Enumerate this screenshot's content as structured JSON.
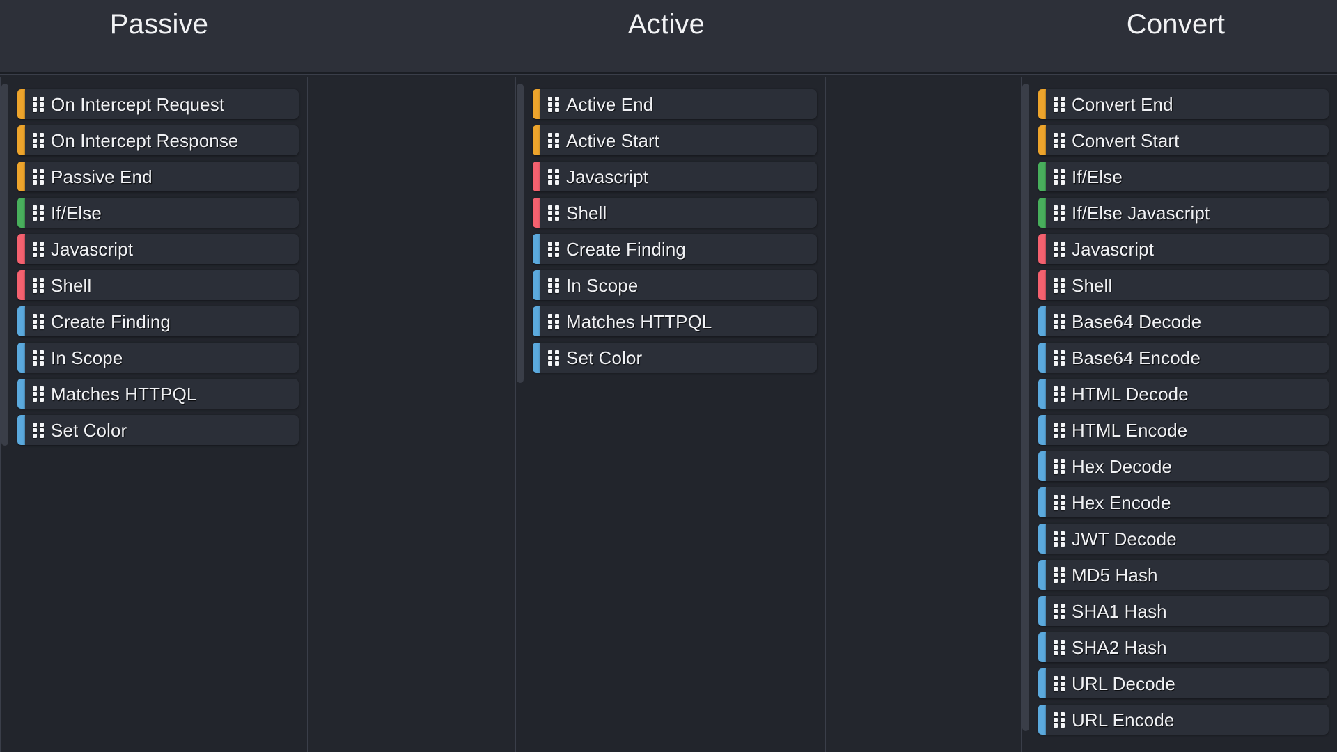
{
  "colors": {
    "stripe_orange": "#eda42c",
    "stripe_green": "#48af5c",
    "stripe_red": "#f4616f",
    "stripe_blue": "#5ba9dd",
    "header_background": "#2d3039",
    "panel_background": "#22252c",
    "item_background": "#2b2f38",
    "text": "#f0f1f4",
    "divider": "#3a3e49"
  },
  "columns": [
    {
      "id": "passive",
      "title": "Passive",
      "items": [
        {
          "label": "On Intercept Request",
          "color": "#eda42c",
          "icon": "drag-handle-icon"
        },
        {
          "label": "On Intercept Response",
          "color": "#eda42c",
          "icon": "drag-handle-icon"
        },
        {
          "label": "Passive End",
          "color": "#eda42c",
          "icon": "drag-handle-icon"
        },
        {
          "label": "If/Else",
          "color": "#48af5c",
          "icon": "drag-handle-icon"
        },
        {
          "label": "Javascript",
          "color": "#f4616f",
          "icon": "drag-handle-icon"
        },
        {
          "label": "Shell",
          "color": "#f4616f",
          "icon": "drag-handle-icon"
        },
        {
          "label": "Create Finding",
          "color": "#5ba9dd",
          "icon": "drag-handle-icon"
        },
        {
          "label": "In Scope",
          "color": "#5ba9dd",
          "icon": "drag-handle-icon"
        },
        {
          "label": "Matches HTTPQL",
          "color": "#5ba9dd",
          "icon": "drag-handle-icon"
        },
        {
          "label": "Set Color",
          "color": "#5ba9dd",
          "icon": "drag-handle-icon"
        }
      ]
    },
    {
      "id": "active",
      "title": "Active",
      "items": [
        {
          "label": "Active End",
          "color": "#eda42c",
          "icon": "drag-handle-icon"
        },
        {
          "label": "Active Start",
          "color": "#eda42c",
          "icon": "drag-handle-icon"
        },
        {
          "label": "Javascript",
          "color": "#f4616f",
          "icon": "drag-handle-icon"
        },
        {
          "label": "Shell",
          "color": "#f4616f",
          "icon": "drag-handle-icon"
        },
        {
          "label": "Create Finding",
          "color": "#5ba9dd",
          "icon": "drag-handle-icon"
        },
        {
          "label": "In Scope",
          "color": "#5ba9dd",
          "icon": "drag-handle-icon"
        },
        {
          "label": "Matches HTTPQL",
          "color": "#5ba9dd",
          "icon": "drag-handle-icon"
        },
        {
          "label": "Set Color",
          "color": "#5ba9dd",
          "icon": "drag-handle-icon"
        }
      ]
    },
    {
      "id": "convert",
      "title": "Convert",
      "items": [
        {
          "label": "Convert End",
          "color": "#eda42c",
          "icon": "drag-handle-icon"
        },
        {
          "label": "Convert Start",
          "color": "#eda42c",
          "icon": "drag-handle-icon"
        },
        {
          "label": "If/Else",
          "color": "#48af5c",
          "icon": "drag-handle-icon"
        },
        {
          "label": "If/Else Javascript",
          "color": "#48af5c",
          "icon": "drag-handle-icon"
        },
        {
          "label": "Javascript",
          "color": "#f4616f",
          "icon": "drag-handle-icon"
        },
        {
          "label": "Shell",
          "color": "#f4616f",
          "icon": "drag-handle-icon"
        },
        {
          "label": "Base64 Decode",
          "color": "#5ba9dd",
          "icon": "drag-handle-icon"
        },
        {
          "label": "Base64 Encode",
          "color": "#5ba9dd",
          "icon": "drag-handle-icon"
        },
        {
          "label": "HTML Decode",
          "color": "#5ba9dd",
          "icon": "drag-handle-icon"
        },
        {
          "label": "HTML Encode",
          "color": "#5ba9dd",
          "icon": "drag-handle-icon"
        },
        {
          "label": "Hex Decode",
          "color": "#5ba9dd",
          "icon": "drag-handle-icon"
        },
        {
          "label": "Hex Encode",
          "color": "#5ba9dd",
          "icon": "drag-handle-icon"
        },
        {
          "label": "JWT Decode",
          "color": "#5ba9dd",
          "icon": "drag-handle-icon"
        },
        {
          "label": "MD5 Hash",
          "color": "#5ba9dd",
          "icon": "drag-handle-icon"
        },
        {
          "label": "SHA1 Hash",
          "color": "#5ba9dd",
          "icon": "drag-handle-icon"
        },
        {
          "label": "SHA2 Hash",
          "color": "#5ba9dd",
          "icon": "drag-handle-icon"
        },
        {
          "label": "URL Decode",
          "color": "#5ba9dd",
          "icon": "drag-handle-icon"
        },
        {
          "label": "URL Encode",
          "color": "#5ba9dd",
          "icon": "drag-handle-icon"
        }
      ]
    }
  ]
}
